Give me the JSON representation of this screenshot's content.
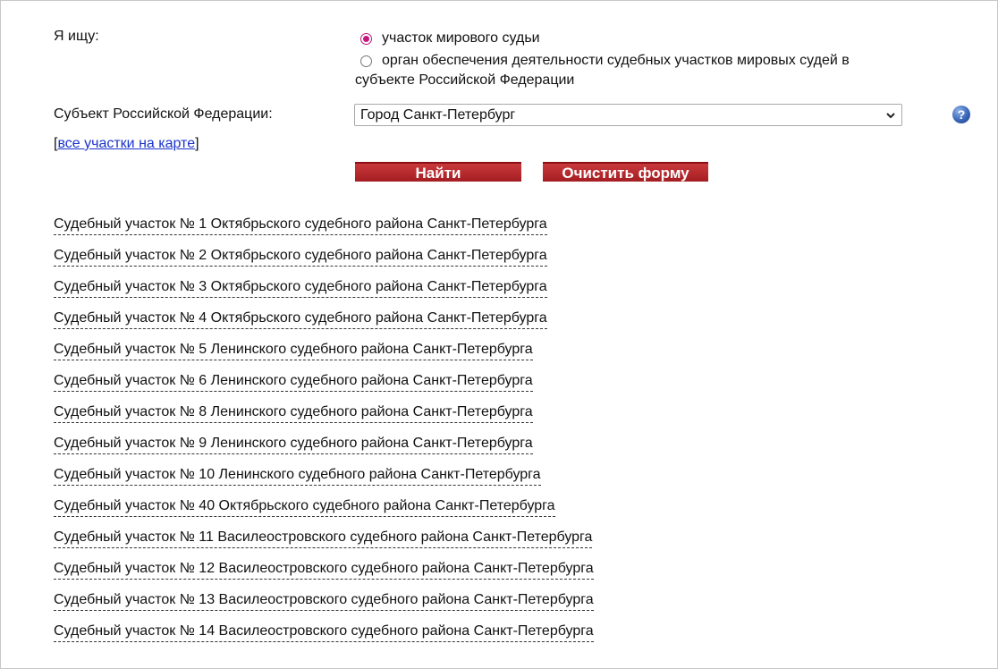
{
  "form": {
    "search_label": "Я ищу:",
    "options": [
      {
        "label": "участок мирового судьи",
        "selected": true
      },
      {
        "label_line1": "орган обеспечения деятельности судебных участков мировых судей в",
        "label_line2": "субъекте Российской Федерации",
        "selected": false
      }
    ],
    "subject_label": "Субъект Российской Федерации:",
    "subject_value": "Город Санкт-Петербург",
    "map_bracket_open": "[",
    "map_link": "все участки на карте",
    "map_bracket_close": "]",
    "find_button": "Найти",
    "clear_button": "Очистить форму",
    "help_icon": "?"
  },
  "colors": {
    "button": "#b02a2e",
    "radio_accent": "#c2187d",
    "link": "#1a33cc"
  },
  "results": [
    "Судебный участок № 1 Октябрьского судебного района Санкт-Петербурга",
    "Судебный участок № 2 Октябрьского судебного района Санкт-Петербурга",
    "Судебный участок № 3 Октябрьского судебного района Санкт-Петербурга",
    "Судебный участок № 4 Октябрьского судебного района Санкт-Петербурга",
    "Судебный участок № 5 Ленинского судебного района Санкт-Петербурга",
    "Судебный участок № 6 Ленинского судебного района Санкт-Петербурга",
    "Судебный участок № 8 Ленинского судебного района Санкт-Петербурга",
    "Судебный участок № 9 Ленинского судебного района Санкт-Петербурга",
    "Судебный участок № 10 Ленинского судебного района Санкт-Петербурга",
    "Судебный участок № 40 Октябрьского судебного района Санкт-Петербурга",
    "Судебный участок № 11 Василеостровского судебного района Санкт-Петербурга",
    "Судебный участок № 12 Василеостровского судебного района Санкт-Петербурга",
    "Судебный участок № 13 Василеостровского судебного района Санкт-Петербурга",
    "Судебный участок № 14 Василеостровского судебного района Санкт-Петербурга"
  ]
}
